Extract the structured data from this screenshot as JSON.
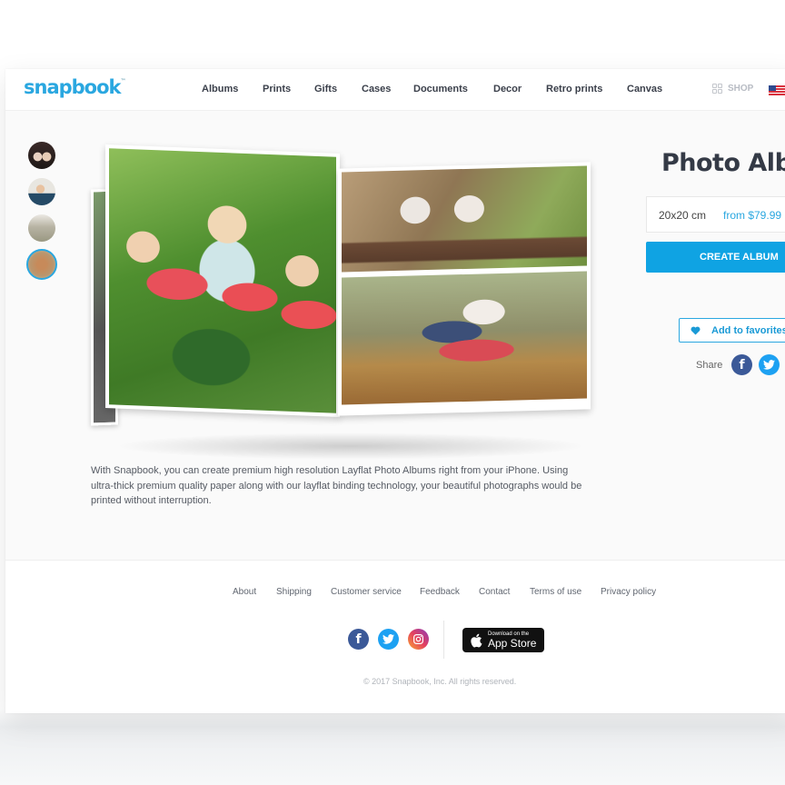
{
  "brand": {
    "name": "snapbook",
    "trademark": "™",
    "color": "#2aa7e0"
  },
  "nav": {
    "items": [
      {
        "label": "Albums"
      },
      {
        "label": "Prints"
      },
      {
        "label": "Gifts"
      },
      {
        "label": "Cases"
      },
      {
        "label": "Documents"
      },
      {
        "label": "Decor"
      },
      {
        "label": "Retro prints"
      },
      {
        "label": "Canvas"
      }
    ],
    "shop_label": "SHOP",
    "shop_icon": "grid-icon",
    "locale_icon": "us-flag-icon"
  },
  "gallery": {
    "thumbnails": [
      {
        "name": "thumb-1",
        "active": false
      },
      {
        "name": "thumb-2",
        "active": false
      },
      {
        "name": "thumb-3",
        "active": false
      },
      {
        "name": "thumb-4",
        "active": true
      }
    ]
  },
  "product": {
    "title": "Photo Album",
    "size": "20x20 cm",
    "price": "from $79.99",
    "create_label": "CREATE ALBUM",
    "favorites_label": "Add to favorites",
    "share_label": "Share",
    "accent": "#0fa3e3"
  },
  "description": "With Snapbook, you can create premium high resolution Layflat Photo Albums right from your iPhone. Using ultra-thick premium quality paper along with our layflat binding technology, your beautiful photographs would be printed without interruption.",
  "footer": {
    "links": [
      {
        "label": "About"
      },
      {
        "label": "Shipping"
      },
      {
        "label": "Customer service"
      },
      {
        "label": "Feedback"
      },
      {
        "label": "Contact"
      },
      {
        "label": "Terms of use"
      },
      {
        "label": "Privacy policy"
      }
    ],
    "appstore_small": "Download on the",
    "appstore_big": "App Store",
    "copyright": "© 2017 Snapbook, Inc. All rights reserved."
  }
}
